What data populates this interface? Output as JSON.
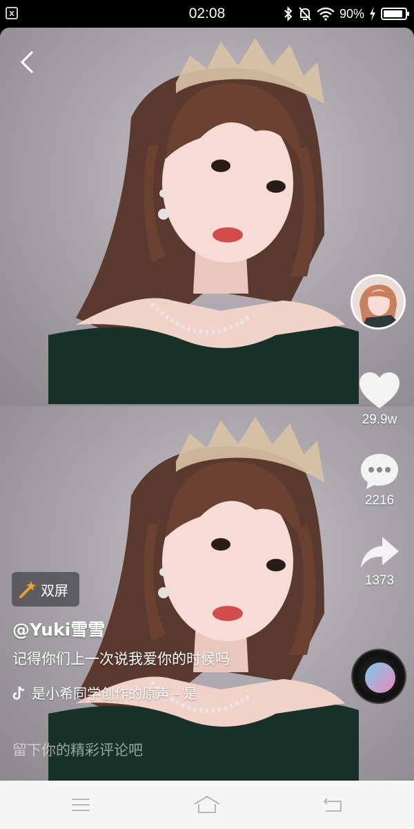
{
  "status_bar": {
    "time": "02:08",
    "battery_text": "90%",
    "battery_level": 0.9,
    "icons": [
      "app-notification-icon",
      "bluetooth-icon",
      "mute-icon",
      "wifi-icon",
      "charging-icon"
    ]
  },
  "video": {
    "description_icons": [
      "back-icon"
    ]
  },
  "actions": {
    "like_count": "29.9w",
    "comment_count": "2216",
    "share_count": "1373"
  },
  "info": {
    "dual_screen_label": "双屏",
    "username": "@Yuki雪雪",
    "caption": "记得你们上一次说我爱你的时候吗",
    "music_text": "是小希同学创作的原声 - 是"
  },
  "comment_input": {
    "placeholder": "留下你的精彩评论吧"
  },
  "colors": {
    "background": "#000000",
    "nav_bar": "#f5f5f5",
    "accent": "#f0a030"
  }
}
